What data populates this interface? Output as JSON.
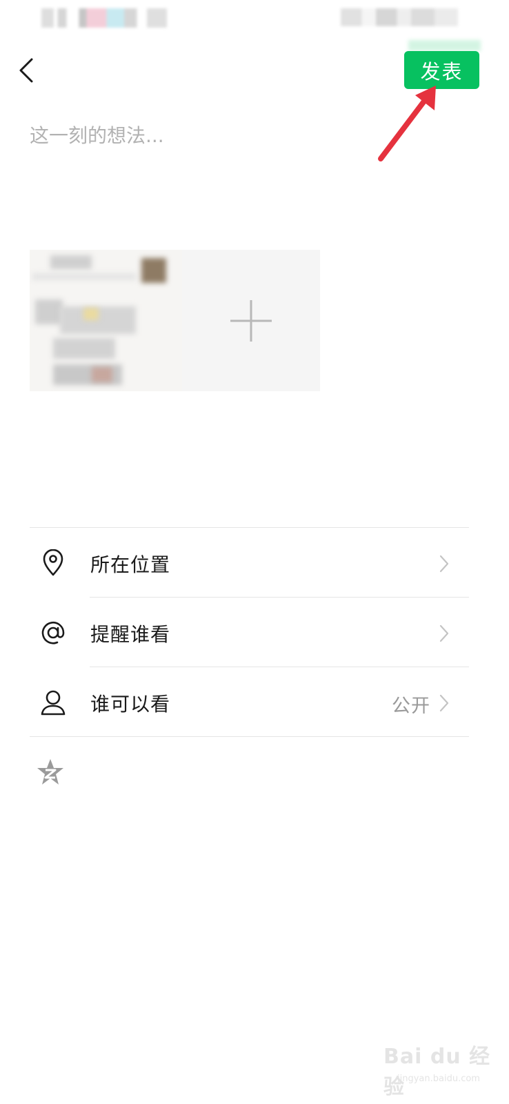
{
  "header": {
    "publish_label": "发表",
    "accent_color": "#07c160"
  },
  "composer": {
    "placeholder": "这一刻的想法..."
  },
  "media": {
    "add_icon": "plus-icon"
  },
  "options": [
    {
      "label": "所在位置",
      "icon": "location-pin-icon",
      "value": ""
    },
    {
      "label": "提醒谁看",
      "icon": "at-sign-icon",
      "value": ""
    },
    {
      "label": "谁可以看",
      "icon": "person-icon",
      "value": "公开"
    }
  ],
  "share": {
    "icon": "qzone-star-icon"
  },
  "annotation": {
    "arrow_color": "#e5323e"
  },
  "watermark": {
    "main": "Bai du 经验",
    "sub": "jingyan.baidu.com"
  }
}
